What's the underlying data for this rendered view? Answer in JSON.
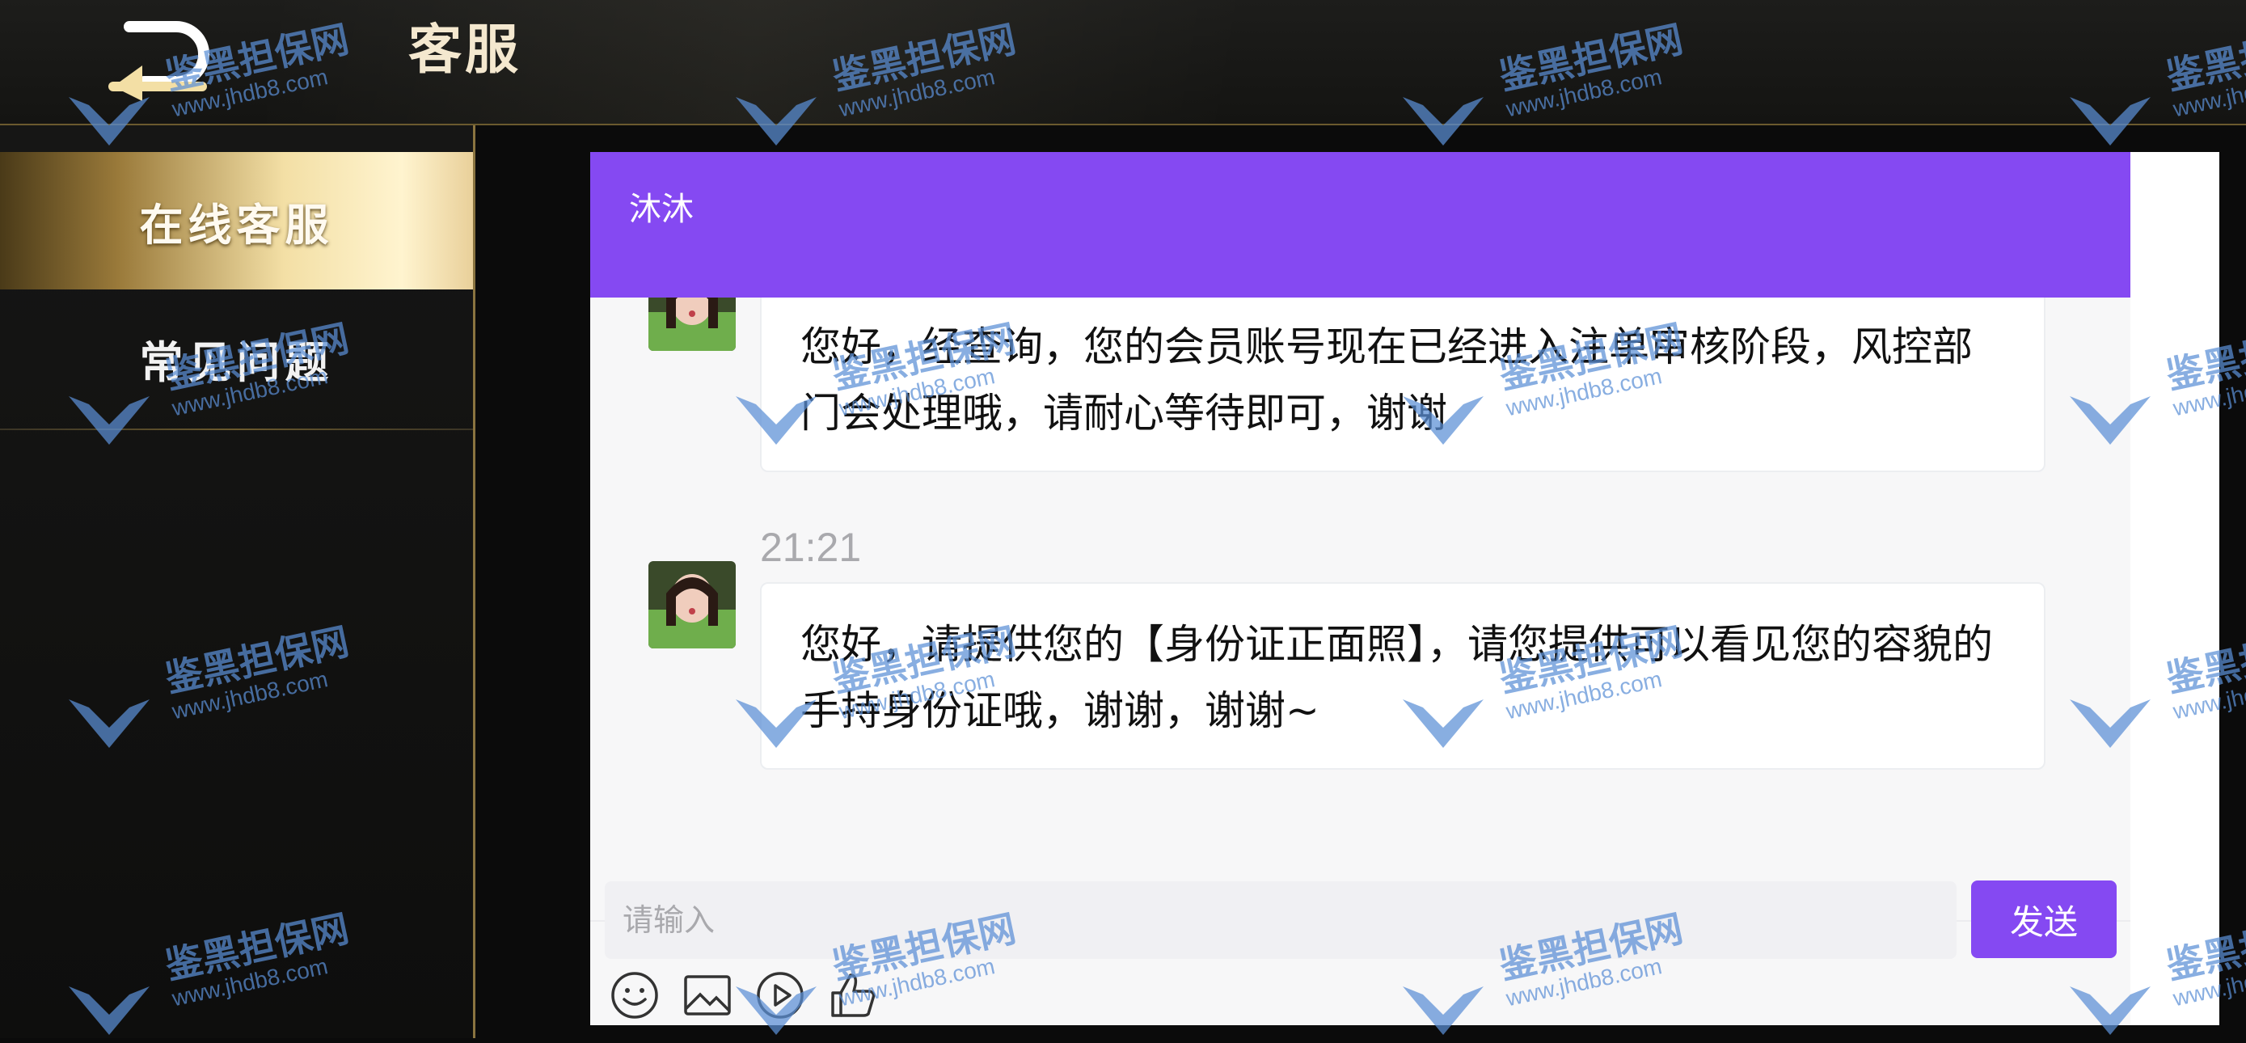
{
  "header": {
    "title": "客服"
  },
  "sidebar": {
    "items": [
      {
        "label": "在线客服",
        "active": true
      },
      {
        "label": "常见问题",
        "active": false
      }
    ]
  },
  "chat": {
    "agent_name": "沐沐",
    "messages": [
      {
        "text": "您好，经查询，您的会员账号现在已经进入注单审核阶段，风控部门会处理哦，请耐心等待即可，谢谢"
      },
      {
        "time": "21:21",
        "text": "您好，请提供您的【身份证正面照】，请您提供可以看见您的容貌的手持身份证哦，谢谢，谢谢~"
      }
    ],
    "toolbar": [
      "emoji-icon",
      "image-icon",
      "video-icon",
      "thumbs-up-icon"
    ],
    "input_placeholder": "请输入",
    "send_label": "发送"
  },
  "watermark": {
    "title": "鉴黑担保网",
    "url": "www.jhdb8.com"
  },
  "colors": {
    "accent": "#8549f2",
    "gold": "#f3dfa5",
    "background": "#0b0b0b"
  }
}
